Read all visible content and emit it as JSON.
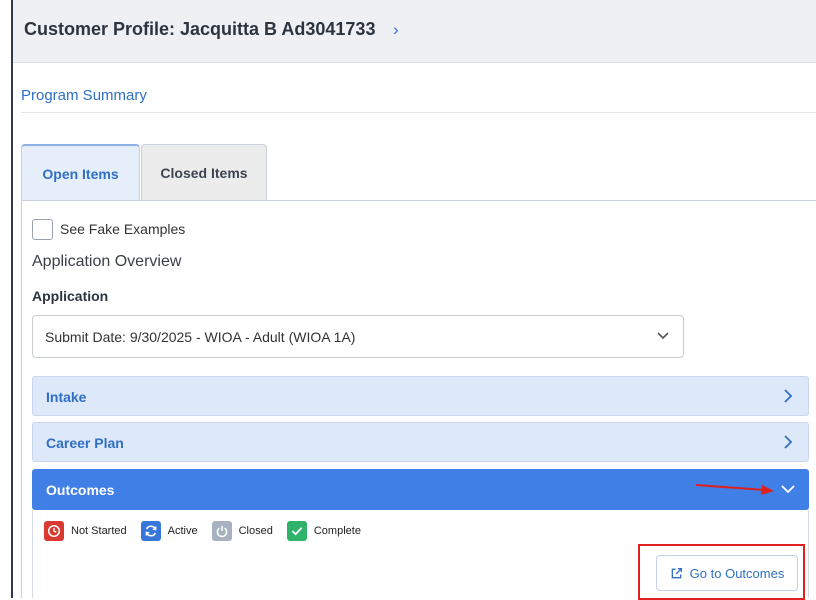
{
  "header": {
    "title": "Customer Profile: Jacquitta B Ad3041733"
  },
  "program_summary": "Program Summary",
  "tabs": [
    {
      "label": "Open Items",
      "active": true
    },
    {
      "label": "Closed Items",
      "active": false
    }
  ],
  "fake_examples": {
    "label": "See Fake Examples",
    "checked": false
  },
  "application_overview": {
    "heading": "Application Overview",
    "field_label": "Application",
    "selected_value": "Submit Date: 9/30/2025 - WIOA - Adult (WIOA 1A)"
  },
  "accordions": [
    {
      "label": "Intake",
      "expanded": false
    },
    {
      "label": "Career Plan",
      "expanded": false
    },
    {
      "label": "Outcomes",
      "expanded": true
    }
  ],
  "legend": [
    {
      "label": "Not Started",
      "icon": "clock-icon",
      "color": "#d83a32"
    },
    {
      "label": "Active",
      "icon": "refresh-icon",
      "color": "#3877da"
    },
    {
      "label": "Closed",
      "icon": "power-icon",
      "color": "#a7b1bf"
    },
    {
      "label": "Complete",
      "icon": "check-icon",
      "color": "#2fb36b"
    }
  ],
  "outcomes": {
    "button_label": "Go to Outcomes"
  },
  "colors": {
    "accent": "#3f7fe6",
    "link": "#2f6fc4",
    "annotation": "#e02020"
  }
}
